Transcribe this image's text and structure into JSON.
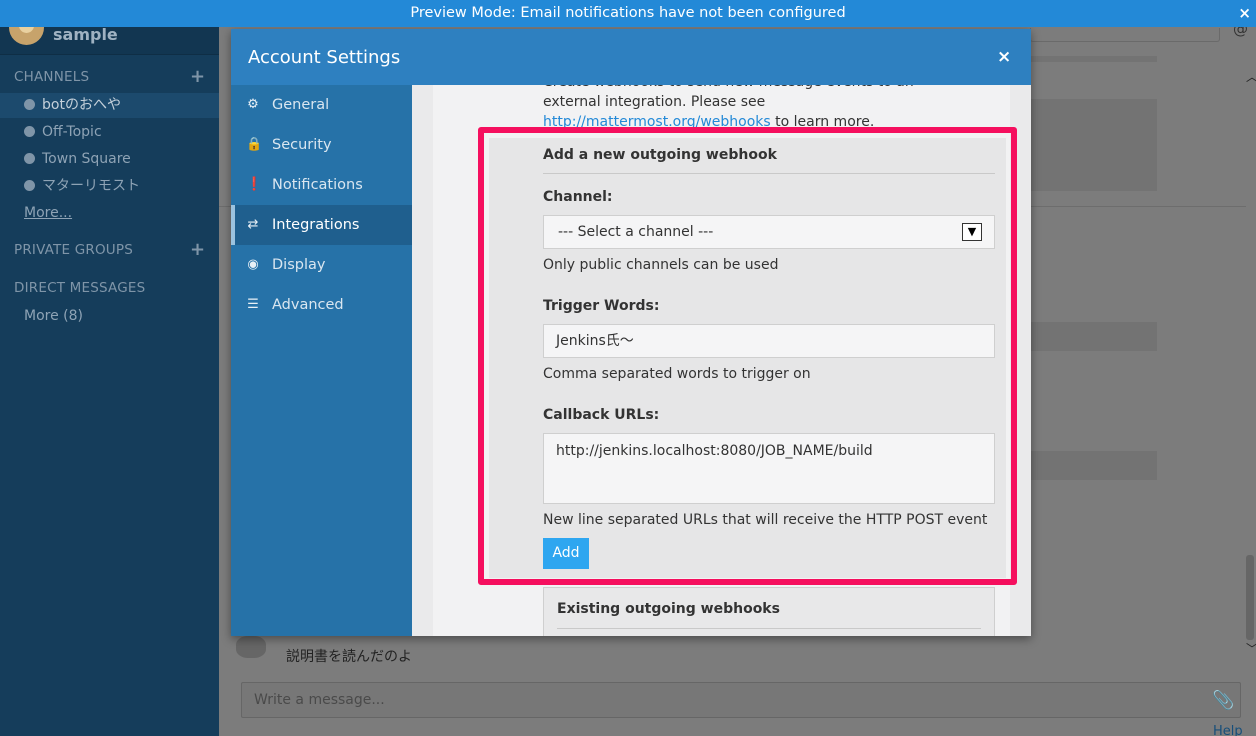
{
  "banner": {
    "text": "Preview Mode: Email notifications have not been configured",
    "close": "×"
  },
  "team": {
    "name": "sample"
  },
  "sidebar": {
    "channels_title": "CHANNELS",
    "channels": [
      {
        "label": "botのおへや",
        "active": true
      },
      {
        "label": "Off-Topic",
        "active": false
      },
      {
        "label": "Town Square",
        "active": false
      },
      {
        "label": "マターリモスト",
        "active": false
      }
    ],
    "more_link": "More...",
    "private_groups_title": "PRIVATE GROUPS",
    "direct_messages_title": "DIRECT MESSAGES",
    "dm_more": "More (8)",
    "plus": "+"
  },
  "background": {
    "message_text": "説明書を読んだのよ",
    "message_placeholder": "Write a message...",
    "help": "Help"
  },
  "modal": {
    "title": "Account Settings",
    "close": "×",
    "nav": [
      {
        "label": "General",
        "icon": "gear-icon",
        "glyph": "⚙"
      },
      {
        "label": "Security",
        "icon": "lock-icon",
        "glyph": "🔒"
      },
      {
        "label": "Notifications",
        "icon": "alert-circle-icon",
        "glyph": "❗"
      },
      {
        "label": "Integrations",
        "icon": "exchange-icon",
        "glyph": "⇄",
        "active": true
      },
      {
        "label": "Display",
        "icon": "eye-icon",
        "glyph": "◉"
      },
      {
        "label": "Advanced",
        "icon": "list-icon",
        "glyph": "☰"
      }
    ],
    "intro": {
      "text_before": "Create webhooks to send new message events to an external integration. Please see ",
      "link": "http://mattermost.org/webhooks",
      "text_after": " to learn more."
    },
    "outgoing": {
      "heading": "Add a new outgoing webhook",
      "channel_label": "Channel:",
      "channel_value": "--- Select a channel ---",
      "channel_help": "Only public channels can be used",
      "trigger_label": "Trigger Words:",
      "trigger_value": "Jenkins氏〜",
      "trigger_help": "Comma separated words to trigger on",
      "callback_label": "Callback URLs:",
      "callback_value": "http://jenkins.localhost:8080/JOB_NAME/build",
      "callback_help": "New line separated URLs that will receive the HTTP POST event",
      "add_button": "Add"
    },
    "existing": {
      "heading": "Existing outgoing webhooks"
    }
  },
  "colors": {
    "banner": "#2389d7",
    "sidebar": "#153d5b",
    "modal_header": "#2e80c0",
    "settings_nav": "#2672a8",
    "add_button": "#2ea6f0",
    "highlight": "#f50f5e"
  }
}
